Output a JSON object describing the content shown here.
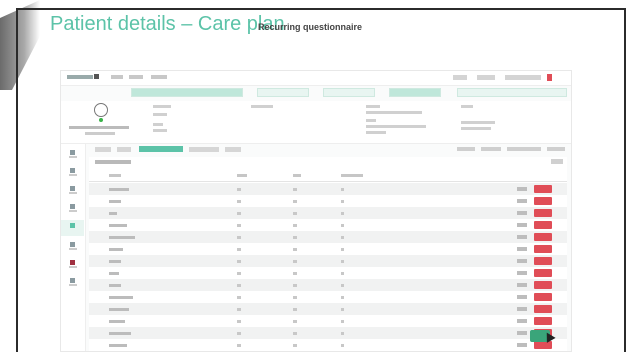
{
  "slide": {
    "title": "Patient details – Care plan",
    "subtitle": "Recurring questionnaire"
  },
  "colors": {
    "accent": "#5cc3a8",
    "frame": "#2b2b2b",
    "delete": "#e04d57",
    "success": "#3aa57a"
  },
  "app": {
    "sidebar_icons": [
      "home-icon",
      "calendar-icon",
      "list-icon",
      "chat-icon",
      "care-plan-icon",
      "document-icon",
      "alert-icon",
      "settings-icon"
    ],
    "active_sidebar_index": 4,
    "table": {
      "row_count": 15,
      "row_actions": [
        "edit",
        "delete"
      ]
    }
  }
}
